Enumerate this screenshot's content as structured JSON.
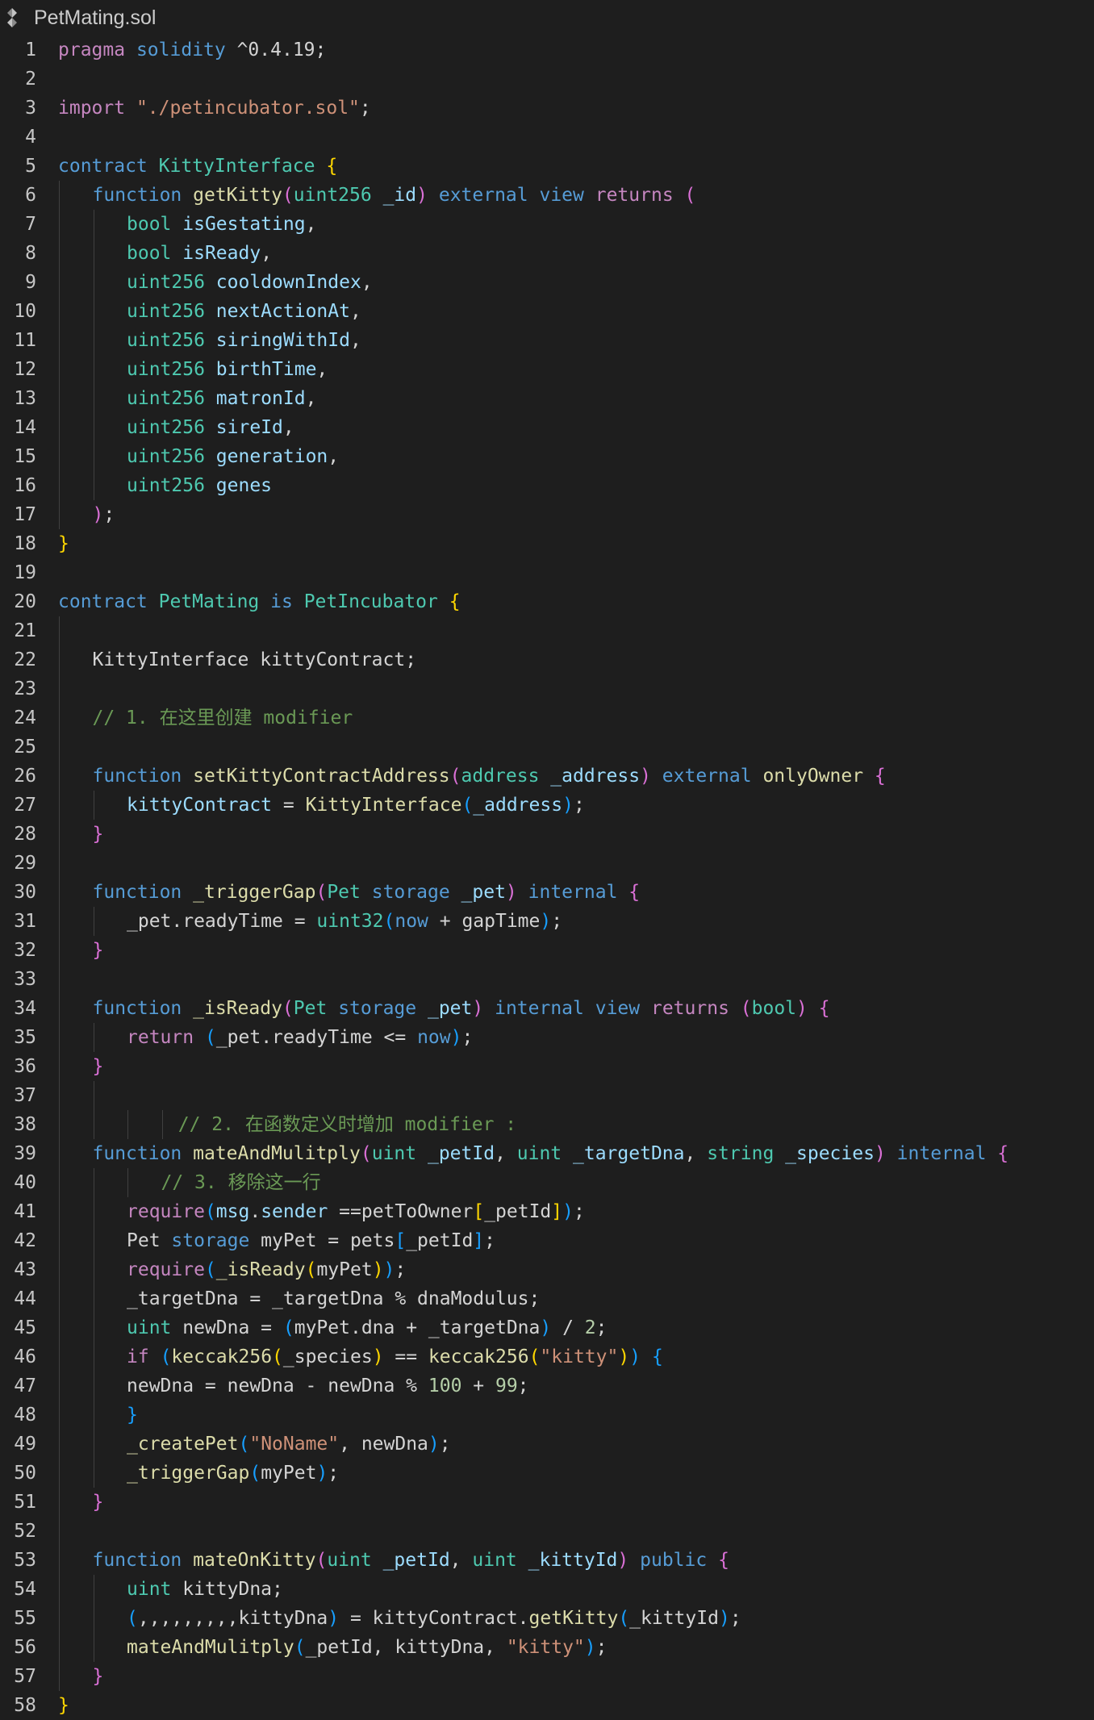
{
  "tab": {
    "filename": "PetMating.sol",
    "icon": "solidity-file-icon"
  },
  "colors": {
    "background": "#1e1e1e",
    "keyword": "#569cd6",
    "control": "#c586c0",
    "type": "#4ec9b0",
    "function": "#dcdcaa",
    "variable": "#9cdcfe",
    "string": "#ce9178",
    "number": "#b5cea8",
    "comment": "#6a9955",
    "bracket_level1": "#ffd700",
    "bracket_level2": "#da70d6",
    "bracket_level3": "#179fff"
  },
  "lines": [
    {
      "n": 1,
      "indent": 0,
      "tokens": [
        [
          "ct",
          "pragma"
        ],
        [
          "pl",
          " "
        ],
        [
          "kw",
          "solidity"
        ],
        [
          "pl",
          " ^0.4.19;"
        ]
      ]
    },
    {
      "n": 2,
      "indent": 0,
      "tokens": []
    },
    {
      "n": 3,
      "indent": 0,
      "tokens": [
        [
          "ct",
          "import"
        ],
        [
          "pl",
          " "
        ],
        [
          "str",
          "\"./petincubator.sol\""
        ],
        [
          "pl",
          ";"
        ]
      ]
    },
    {
      "n": 4,
      "indent": 0,
      "tokens": []
    },
    {
      "n": 5,
      "indent": 0,
      "tokens": [
        [
          "kw",
          "contract"
        ],
        [
          "pl",
          " "
        ],
        [
          "ty",
          "KittyInterface"
        ],
        [
          "pl",
          " "
        ],
        [
          "b1",
          "{"
        ]
      ]
    },
    {
      "n": 6,
      "indent": 1,
      "tokens": [
        [
          "kw",
          "function"
        ],
        [
          "pl",
          " "
        ],
        [
          "fn",
          "getKitty"
        ],
        [
          "b2",
          "("
        ],
        [
          "ty",
          "uint256"
        ],
        [
          "pl",
          " "
        ],
        [
          "var",
          "_id"
        ],
        [
          "b2",
          ")"
        ],
        [
          "pl",
          " "
        ],
        [
          "kw",
          "external"
        ],
        [
          "pl",
          " "
        ],
        [
          "kw",
          "view"
        ],
        [
          "pl",
          " "
        ],
        [
          "ct",
          "returns"
        ],
        [
          "pl",
          " "
        ],
        [
          "b2",
          "("
        ]
      ]
    },
    {
      "n": 7,
      "indent": 2,
      "tokens": [
        [
          "ty",
          "bool"
        ],
        [
          "pl",
          " "
        ],
        [
          "var",
          "isGestating"
        ],
        [
          "pl",
          ","
        ]
      ]
    },
    {
      "n": 8,
      "indent": 2,
      "tokens": [
        [
          "ty",
          "bool"
        ],
        [
          "pl",
          " "
        ],
        [
          "var",
          "isReady"
        ],
        [
          "pl",
          ","
        ]
      ]
    },
    {
      "n": 9,
      "indent": 2,
      "tokens": [
        [
          "ty",
          "uint256"
        ],
        [
          "pl",
          " "
        ],
        [
          "var",
          "cooldownIndex"
        ],
        [
          "pl",
          ","
        ]
      ]
    },
    {
      "n": 10,
      "indent": 2,
      "tokens": [
        [
          "ty",
          "uint256"
        ],
        [
          "pl",
          " "
        ],
        [
          "var",
          "nextActionAt"
        ],
        [
          "pl",
          ","
        ]
      ]
    },
    {
      "n": 11,
      "indent": 2,
      "tokens": [
        [
          "ty",
          "uint256"
        ],
        [
          "pl",
          " "
        ],
        [
          "var",
          "siringWithId"
        ],
        [
          "pl",
          ","
        ]
      ]
    },
    {
      "n": 12,
      "indent": 2,
      "tokens": [
        [
          "ty",
          "uint256"
        ],
        [
          "pl",
          " "
        ],
        [
          "var",
          "birthTime"
        ],
        [
          "pl",
          ","
        ]
      ]
    },
    {
      "n": 13,
      "indent": 2,
      "tokens": [
        [
          "ty",
          "uint256"
        ],
        [
          "pl",
          " "
        ],
        [
          "var",
          "matronId"
        ],
        [
          "pl",
          ","
        ]
      ]
    },
    {
      "n": 14,
      "indent": 2,
      "tokens": [
        [
          "ty",
          "uint256"
        ],
        [
          "pl",
          " "
        ],
        [
          "var",
          "sireId"
        ],
        [
          "pl",
          ","
        ]
      ]
    },
    {
      "n": 15,
      "indent": 2,
      "tokens": [
        [
          "ty",
          "uint256"
        ],
        [
          "pl",
          " "
        ],
        [
          "var",
          "generation"
        ],
        [
          "pl",
          ","
        ]
      ]
    },
    {
      "n": 16,
      "indent": 2,
      "tokens": [
        [
          "ty",
          "uint256"
        ],
        [
          "pl",
          " "
        ],
        [
          "var",
          "genes"
        ]
      ]
    },
    {
      "n": 17,
      "indent": 1,
      "tokens": [
        [
          "b2",
          ")"
        ],
        [
          "pl",
          ";"
        ]
      ]
    },
    {
      "n": 18,
      "indent": 0,
      "tokens": [
        [
          "b1",
          "}"
        ]
      ]
    },
    {
      "n": 19,
      "indent": 0,
      "tokens": []
    },
    {
      "n": 20,
      "indent": 0,
      "tokens": [
        [
          "kw",
          "contract"
        ],
        [
          "pl",
          " "
        ],
        [
          "ty",
          "PetMating"
        ],
        [
          "pl",
          " "
        ],
        [
          "kw",
          "is"
        ],
        [
          "pl",
          " "
        ],
        [
          "ty",
          "PetIncubator"
        ],
        [
          "pl",
          " "
        ],
        [
          "b1",
          "{"
        ]
      ]
    },
    {
      "n": 21,
      "indent": 0,
      "tokens": []
    },
    {
      "n": 22,
      "indent": 1,
      "tokens": [
        [
          "pl",
          "KittyInterface kittyContract;"
        ]
      ]
    },
    {
      "n": 23,
      "indent": 0,
      "tokens": []
    },
    {
      "n": 24,
      "indent": 1,
      "tokens": [
        [
          "cm",
          "// 1. 在这里创建 modifier"
        ]
      ]
    },
    {
      "n": 25,
      "indent": 0,
      "tokens": []
    },
    {
      "n": 26,
      "indent": 1,
      "tokens": [
        [
          "kw",
          "function"
        ],
        [
          "pl",
          " "
        ],
        [
          "fn",
          "setKittyContractAddress"
        ],
        [
          "b2",
          "("
        ],
        [
          "ty",
          "address"
        ],
        [
          "pl",
          " "
        ],
        [
          "var",
          "_address"
        ],
        [
          "b2",
          ")"
        ],
        [
          "pl",
          " "
        ],
        [
          "kw",
          "external"
        ],
        [
          "pl",
          " "
        ],
        [
          "fn",
          "onlyOwner"
        ],
        [
          "pl",
          " "
        ],
        [
          "b2",
          "{"
        ]
      ]
    },
    {
      "n": 27,
      "indent": 2,
      "tokens": [
        [
          "var",
          "kittyContract"
        ],
        [
          "pl",
          " = "
        ],
        [
          "fn",
          "KittyInterface"
        ],
        [
          "b3",
          "("
        ],
        [
          "var",
          "_address"
        ],
        [
          "b3",
          ")"
        ],
        [
          "pl",
          ";"
        ]
      ]
    },
    {
      "n": 28,
      "indent": 1,
      "tokens": [
        [
          "b2",
          "}"
        ]
      ]
    },
    {
      "n": 29,
      "indent": 0,
      "tokens": []
    },
    {
      "n": 30,
      "indent": 1,
      "tokens": [
        [
          "kw",
          "function"
        ],
        [
          "pl",
          " "
        ],
        [
          "fn",
          "_triggerGap"
        ],
        [
          "b2",
          "("
        ],
        [
          "ty",
          "Pet"
        ],
        [
          "pl",
          " "
        ],
        [
          "kw",
          "storage"
        ],
        [
          "pl",
          " "
        ],
        [
          "var",
          "_pet"
        ],
        [
          "b2",
          ")"
        ],
        [
          "pl",
          " "
        ],
        [
          "kw",
          "internal"
        ],
        [
          "pl",
          " "
        ],
        [
          "b2",
          "{"
        ]
      ]
    },
    {
      "n": 31,
      "indent": 2,
      "tokens": [
        [
          "pl",
          "_pet.readyTime = "
        ],
        [
          "ty",
          "uint32"
        ],
        [
          "b3",
          "("
        ],
        [
          "kw",
          "now"
        ],
        [
          "pl",
          " + gapTime"
        ],
        [
          "b3",
          ")"
        ],
        [
          "pl",
          ";"
        ]
      ]
    },
    {
      "n": 32,
      "indent": 1,
      "tokens": [
        [
          "b2",
          "}"
        ]
      ]
    },
    {
      "n": 33,
      "indent": 0,
      "tokens": []
    },
    {
      "n": 34,
      "indent": 1,
      "tokens": [
        [
          "kw",
          "function"
        ],
        [
          "pl",
          " "
        ],
        [
          "fn",
          "_isReady"
        ],
        [
          "b2",
          "("
        ],
        [
          "ty",
          "Pet"
        ],
        [
          "pl",
          " "
        ],
        [
          "kw",
          "storage"
        ],
        [
          "pl",
          " "
        ],
        [
          "var",
          "_pet"
        ],
        [
          "b2",
          ")"
        ],
        [
          "pl",
          " "
        ],
        [
          "kw",
          "internal"
        ],
        [
          "pl",
          " "
        ],
        [
          "kw",
          "view"
        ],
        [
          "pl",
          " "
        ],
        [
          "ct",
          "returns"
        ],
        [
          "pl",
          " "
        ],
        [
          "b2",
          "("
        ],
        [
          "ty",
          "bool"
        ],
        [
          "b2",
          ")"
        ],
        [
          "pl",
          " "
        ],
        [
          "b2",
          "{"
        ]
      ]
    },
    {
      "n": 35,
      "indent": 2,
      "tokens": [
        [
          "ct",
          "return"
        ],
        [
          "pl",
          " "
        ],
        [
          "b3",
          "("
        ],
        [
          "pl",
          "_pet.readyTime <= "
        ],
        [
          "kw",
          "now"
        ],
        [
          "b3",
          ")"
        ],
        [
          "pl",
          ";"
        ]
      ]
    },
    {
      "n": 36,
      "indent": 1,
      "tokens": [
        [
          "b2",
          "}"
        ]
      ]
    },
    {
      "n": 37,
      "indent": 0,
      "tokens": []
    },
    {
      "n": 38,
      "indent": 3.5,
      "tokens": [
        [
          "cm",
          "// 2. 在函数定义时增加 modifier :"
        ]
      ]
    },
    {
      "n": 39,
      "indent": 1,
      "tokens": [
        [
          "kw",
          "function"
        ],
        [
          "pl",
          " "
        ],
        [
          "fn",
          "mateAndMulitply"
        ],
        [
          "b2",
          "("
        ],
        [
          "ty",
          "uint"
        ],
        [
          "pl",
          " "
        ],
        [
          "var",
          "_petId"
        ],
        [
          "pl",
          ", "
        ],
        [
          "ty",
          "uint"
        ],
        [
          "pl",
          " "
        ],
        [
          "var",
          "_targetDna"
        ],
        [
          "pl",
          ", "
        ],
        [
          "ty",
          "string"
        ],
        [
          "pl",
          " "
        ],
        [
          "var",
          "_species"
        ],
        [
          "b2",
          ")"
        ],
        [
          "pl",
          " "
        ],
        [
          "kw",
          "internal"
        ],
        [
          "pl",
          " "
        ],
        [
          "b2",
          "{"
        ]
      ]
    },
    {
      "n": 40,
      "indent": 3,
      "tokens": [
        [
          "cm",
          "// 3. 移除这一行"
        ]
      ]
    },
    {
      "n": 41,
      "indent": 2,
      "tokens": [
        [
          "ct",
          "require"
        ],
        [
          "b3",
          "("
        ],
        [
          "var",
          "msg"
        ],
        [
          "pl",
          "."
        ],
        [
          "var",
          "sender"
        ],
        [
          "pl",
          " =="
        ],
        [
          "pl",
          "petToOwner"
        ],
        [
          "b1",
          "["
        ],
        [
          "pl",
          "_petId"
        ],
        [
          "b1",
          "]"
        ],
        [
          "b3",
          ")"
        ],
        [
          "pl",
          ";"
        ]
      ]
    },
    {
      "n": 42,
      "indent": 2,
      "tokens": [
        [
          "pl",
          "Pet "
        ],
        [
          "kw",
          "storage"
        ],
        [
          "pl",
          " myPet = pets"
        ],
        [
          "b3",
          "["
        ],
        [
          "pl",
          "_petId"
        ],
        [
          "b3",
          "]"
        ],
        [
          "pl",
          ";"
        ]
      ]
    },
    {
      "n": 43,
      "indent": 2,
      "tokens": [
        [
          "ct",
          "require"
        ],
        [
          "b3",
          "("
        ],
        [
          "fn",
          "_isReady"
        ],
        [
          "b1",
          "("
        ],
        [
          "pl",
          "myPet"
        ],
        [
          "b1",
          ")"
        ],
        [
          "b3",
          ")"
        ],
        [
          "pl",
          ";"
        ]
      ]
    },
    {
      "n": 44,
      "indent": 2,
      "tokens": [
        [
          "pl",
          "_targetDna = _targetDna % dnaModulus;"
        ]
      ]
    },
    {
      "n": 45,
      "indent": 2,
      "tokens": [
        [
          "ty",
          "uint"
        ],
        [
          "pl",
          " newDna = "
        ],
        [
          "b3",
          "("
        ],
        [
          "pl",
          "myPet.dna + _targetDna"
        ],
        [
          "b3",
          ")"
        ],
        [
          "pl",
          " / "
        ],
        [
          "num",
          "2"
        ],
        [
          "pl",
          ";"
        ]
      ]
    },
    {
      "n": 46,
      "indent": 2,
      "tokens": [
        [
          "ct",
          "if"
        ],
        [
          "pl",
          " "
        ],
        [
          "b3",
          "("
        ],
        [
          "fn",
          "keccak256"
        ],
        [
          "b1",
          "("
        ],
        [
          "pl",
          "_species"
        ],
        [
          "b1",
          ")"
        ],
        [
          "pl",
          " == "
        ],
        [
          "fn",
          "keccak256"
        ],
        [
          "b1",
          "("
        ],
        [
          "str",
          "\"kitty\""
        ],
        [
          "b1",
          ")"
        ],
        [
          "b3",
          ")"
        ],
        [
          "pl",
          " "
        ],
        [
          "b3",
          "{"
        ]
      ]
    },
    {
      "n": 47,
      "indent": 2,
      "tokens": [
        [
          "pl",
          "newDna = newDna - newDna % "
        ],
        [
          "num",
          "100"
        ],
        [
          "pl",
          " + "
        ],
        [
          "num",
          "99"
        ],
        [
          "pl",
          ";"
        ]
      ]
    },
    {
      "n": 48,
      "indent": 2,
      "tokens": [
        [
          "b3",
          "}"
        ]
      ]
    },
    {
      "n": 49,
      "indent": 2,
      "tokens": [
        [
          "fn",
          "_createPet"
        ],
        [
          "b3",
          "("
        ],
        [
          "str",
          "\"NoName\""
        ],
        [
          "pl",
          ", newDna"
        ],
        [
          "b3",
          ")"
        ],
        [
          "pl",
          ";"
        ]
      ]
    },
    {
      "n": 50,
      "indent": 2,
      "tokens": [
        [
          "fn",
          "_triggerGap"
        ],
        [
          "b3",
          "("
        ],
        [
          "pl",
          "myPet"
        ],
        [
          "b3",
          ")"
        ],
        [
          "pl",
          ";"
        ]
      ]
    },
    {
      "n": 51,
      "indent": 1,
      "tokens": [
        [
          "b2",
          "}"
        ]
      ]
    },
    {
      "n": 52,
      "indent": 0,
      "tokens": []
    },
    {
      "n": 53,
      "indent": 1,
      "tokens": [
        [
          "kw",
          "function"
        ],
        [
          "pl",
          " "
        ],
        [
          "fn",
          "mateOnKitty"
        ],
        [
          "b2",
          "("
        ],
        [
          "ty",
          "uint"
        ],
        [
          "pl",
          " "
        ],
        [
          "var",
          "_petId"
        ],
        [
          "pl",
          ", "
        ],
        [
          "ty",
          "uint"
        ],
        [
          "pl",
          " "
        ],
        [
          "var",
          "_kittyId"
        ],
        [
          "b2",
          ")"
        ],
        [
          "pl",
          " "
        ],
        [
          "kw",
          "public"
        ],
        [
          "pl",
          " "
        ],
        [
          "b2",
          "{"
        ]
      ]
    },
    {
      "n": 54,
      "indent": 2,
      "tokens": [
        [
          "ty",
          "uint"
        ],
        [
          "pl",
          " kittyDna;"
        ]
      ]
    },
    {
      "n": 55,
      "indent": 2,
      "tokens": [
        [
          "b3",
          "("
        ],
        [
          "pl",
          ",,,,,,,,,kittyDna"
        ],
        [
          "b3",
          ")"
        ],
        [
          "pl",
          " = kittyContract."
        ],
        [
          "fn",
          "getKitty"
        ],
        [
          "b3",
          "("
        ],
        [
          "pl",
          "_kittyId"
        ],
        [
          "b3",
          ")"
        ],
        [
          "pl",
          ";"
        ]
      ]
    },
    {
      "n": 56,
      "indent": 2,
      "tokens": [
        [
          "fn",
          "mateAndMulitply"
        ],
        [
          "b3",
          "("
        ],
        [
          "pl",
          "_petId, kittyDna, "
        ],
        [
          "str",
          "\"kitty\""
        ],
        [
          "b3",
          ")"
        ],
        [
          "pl",
          ";"
        ]
      ]
    },
    {
      "n": 57,
      "indent": 1,
      "tokens": [
        [
          "b2",
          "}"
        ]
      ]
    },
    {
      "n": 58,
      "indent": 0,
      "tokens": [
        [
          "b1",
          "}"
        ]
      ]
    }
  ]
}
